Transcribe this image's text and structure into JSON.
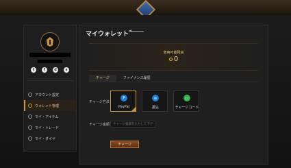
{
  "header": {
    "emblem_icon": "diamond-emblem-icon"
  },
  "sidebar": {
    "social_icons": [
      "twitter-icon",
      "facebook-icon",
      "discord-icon",
      "steam-icon"
    ],
    "menu": [
      {
        "label": "アカウント設定",
        "icon": "account-icon",
        "active": false
      },
      {
        "label": "ウォレット管理",
        "icon": "wallet-icon",
        "active": true
      },
      {
        "label": "マイ・アイテム",
        "icon": "item-icon",
        "active": false
      },
      {
        "label": "マイ・トレード",
        "icon": "trade-icon",
        "active": false
      },
      {
        "label": "マイ・ダイヤ",
        "icon": "diamond-icon",
        "active": false
      }
    ]
  },
  "main": {
    "title": "マイウォレット",
    "balance_label": "使用可能残高",
    "balance_value": "0",
    "tabs": [
      {
        "label": "チャージ",
        "active": true
      },
      {
        "label": "ファイナンス履歴",
        "active": false
      }
    ],
    "charge_method_label": "チャージ方法：",
    "methods": [
      {
        "label": "PayPal",
        "icon": "paypal-icon",
        "color": "#1c7ed6",
        "selected": true
      },
      {
        "label": "振込",
        "icon": "bank-transfer-icon",
        "color": "#1c7ed6",
        "selected": false
      },
      {
        "label": "チャージコード",
        "icon": "code-icon",
        "color": "#2fb344",
        "selected": false
      }
    ],
    "amount_label": "チャージ金額：",
    "amount_placeholder": "チャージ金額を入力して下さい",
    "charge_button": "チャージ"
  }
}
